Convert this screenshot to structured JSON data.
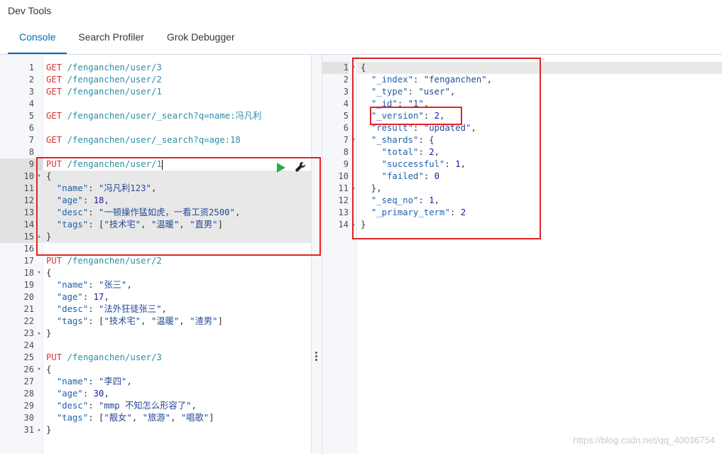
{
  "app": {
    "title": "Dev Tools"
  },
  "tabs": [
    {
      "label": "Console",
      "active": true
    },
    {
      "label": "Search Profiler",
      "active": false
    },
    {
      "label": "Grok Debugger",
      "active": false
    }
  ],
  "request_editor": {
    "lines": [
      {
        "n": "1",
        "tokens": [
          [
            "m",
            "GET "
          ],
          [
            "u",
            "/fenganchen/user/3"
          ]
        ]
      },
      {
        "n": "2",
        "tokens": [
          [
            "m",
            "GET "
          ],
          [
            "u",
            "/fenganchen/user/2"
          ]
        ]
      },
      {
        "n": "3",
        "tokens": [
          [
            "m",
            "GET "
          ],
          [
            "u",
            "/fenganchen/user/1"
          ]
        ]
      },
      {
        "n": "4",
        "tokens": []
      },
      {
        "n": "5",
        "tokens": [
          [
            "m",
            "GET "
          ],
          [
            "u",
            "/fenganchen/user/_search?q=name:冯凡利"
          ]
        ]
      },
      {
        "n": "6",
        "tokens": []
      },
      {
        "n": "7",
        "tokens": [
          [
            "m",
            "GET "
          ],
          [
            "u",
            "/fenganchen/user/_search?q=age:18"
          ]
        ]
      },
      {
        "n": "8",
        "tokens": []
      },
      {
        "n": "9",
        "tokens": [
          [
            "m",
            "PUT "
          ],
          [
            "u",
            "/fenganchen/user/1"
          ]
        ],
        "active": true,
        "cursor": true
      },
      {
        "n": "10",
        "fold": "▾",
        "tokens": [
          [
            "p",
            "{"
          ]
        ],
        "hl": true
      },
      {
        "n": "11",
        "tokens": [
          [
            "p",
            "  "
          ],
          [
            "k",
            "\"name\""
          ],
          [
            "p",
            ": "
          ],
          [
            "s",
            "\"冯凡利123\""
          ],
          [
            "p",
            ","
          ]
        ],
        "hl": true
      },
      {
        "n": "12",
        "tokens": [
          [
            "p",
            "  "
          ],
          [
            "k",
            "\"age\""
          ],
          [
            "p",
            ": "
          ],
          [
            "n",
            "18"
          ],
          [
            "p",
            ","
          ]
        ],
        "hl": true
      },
      {
        "n": "13",
        "tokens": [
          [
            "p",
            "  "
          ],
          [
            "k",
            "\"desc\""
          ],
          [
            "p",
            ": "
          ],
          [
            "s",
            "\"一顿操作猛如虎，一看工资2500\""
          ],
          [
            "p",
            ","
          ]
        ],
        "hl": true
      },
      {
        "n": "14",
        "tokens": [
          [
            "p",
            "  "
          ],
          [
            "k",
            "\"tags\""
          ],
          [
            "p",
            ": ["
          ],
          [
            "s",
            "\"技术宅\""
          ],
          [
            "p",
            ", "
          ],
          [
            "s",
            "\"温暖\""
          ],
          [
            "p",
            ", "
          ],
          [
            "s",
            "\"直男\""
          ],
          [
            "p",
            "]"
          ]
        ],
        "hl": true
      },
      {
        "n": "15",
        "fold": "▴",
        "tokens": [
          [
            "p",
            "}"
          ]
        ],
        "hl": true
      },
      {
        "n": "16",
        "tokens": []
      },
      {
        "n": "17",
        "tokens": [
          [
            "m",
            "PUT "
          ],
          [
            "u",
            "/fenganchen/user/2"
          ]
        ]
      },
      {
        "n": "18",
        "fold": "▾",
        "tokens": [
          [
            "p",
            "{"
          ]
        ]
      },
      {
        "n": "19",
        "tokens": [
          [
            "p",
            "  "
          ],
          [
            "k",
            "\"name\""
          ],
          [
            "p",
            ": "
          ],
          [
            "s",
            "\"张三\""
          ],
          [
            "p",
            ","
          ]
        ]
      },
      {
        "n": "20",
        "tokens": [
          [
            "p",
            "  "
          ],
          [
            "k",
            "\"age\""
          ],
          [
            "p",
            ": "
          ],
          [
            "n",
            "17"
          ],
          [
            "p",
            ","
          ]
        ]
      },
      {
        "n": "21",
        "tokens": [
          [
            "p",
            "  "
          ],
          [
            "k",
            "\"desc\""
          ],
          [
            "p",
            ": "
          ],
          [
            "s",
            "\"法外狂徒张三\""
          ],
          [
            "p",
            ","
          ]
        ]
      },
      {
        "n": "22",
        "tokens": [
          [
            "p",
            "  "
          ],
          [
            "k",
            "\"tags\""
          ],
          [
            "p",
            ": ["
          ],
          [
            "s",
            "\"技术宅\""
          ],
          [
            "p",
            ", "
          ],
          [
            "s",
            "\"温暖\""
          ],
          [
            "p",
            ", "
          ],
          [
            "s",
            "\"渣男\""
          ],
          [
            "p",
            "]"
          ]
        ]
      },
      {
        "n": "23",
        "fold": "▴",
        "tokens": [
          [
            "p",
            "}"
          ]
        ]
      },
      {
        "n": "24",
        "tokens": []
      },
      {
        "n": "25",
        "tokens": [
          [
            "m",
            "PUT "
          ],
          [
            "u",
            "/fenganchen/user/3"
          ]
        ]
      },
      {
        "n": "26",
        "fold": "▾",
        "tokens": [
          [
            "p",
            "{"
          ]
        ]
      },
      {
        "n": "27",
        "tokens": [
          [
            "p",
            "  "
          ],
          [
            "k",
            "\"name\""
          ],
          [
            "p",
            ": "
          ],
          [
            "s",
            "\"李四\""
          ],
          [
            "p",
            ","
          ]
        ]
      },
      {
        "n": "28",
        "tokens": [
          [
            "p",
            "  "
          ],
          [
            "k",
            "\"age\""
          ],
          [
            "p",
            ": "
          ],
          [
            "n",
            "30"
          ],
          [
            "p",
            ","
          ]
        ]
      },
      {
        "n": "29",
        "tokens": [
          [
            "p",
            "  "
          ],
          [
            "k",
            "\"desc\""
          ],
          [
            "p",
            ": "
          ],
          [
            "s",
            "\"mmp 不知怎么形容了\""
          ],
          [
            "p",
            ","
          ]
        ]
      },
      {
        "n": "30",
        "tokens": [
          [
            "p",
            "  "
          ],
          [
            "k",
            "\"tags\""
          ],
          [
            "p",
            ": ["
          ],
          [
            "s",
            "\"靓女\""
          ],
          [
            "p",
            ", "
          ],
          [
            "s",
            "\"旅游\""
          ],
          [
            "p",
            ", "
          ],
          [
            "s",
            "\"唱歌\""
          ],
          [
            "p",
            "]"
          ]
        ]
      },
      {
        "n": "31",
        "fold": "▴",
        "tokens": [
          [
            "p",
            "}"
          ]
        ]
      }
    ]
  },
  "response_viewer": {
    "lines": [
      {
        "n": "1",
        "fold": "▾",
        "tokens": [
          [
            "p",
            "{"
          ]
        ],
        "active": true
      },
      {
        "n": "2",
        "tokens": [
          [
            "p",
            "  "
          ],
          [
            "k",
            "\"_index\""
          ],
          [
            "p",
            ": "
          ],
          [
            "s",
            "\"fenganchen\""
          ],
          [
            "p",
            ","
          ]
        ]
      },
      {
        "n": "3",
        "tokens": [
          [
            "p",
            "  "
          ],
          [
            "k",
            "\"_type\""
          ],
          [
            "p",
            ": "
          ],
          [
            "s",
            "\"user\""
          ],
          [
            "p",
            ","
          ]
        ]
      },
      {
        "n": "4",
        "tokens": [
          [
            "p",
            "  "
          ],
          [
            "k",
            "\"_id\""
          ],
          [
            "p",
            ": "
          ],
          [
            "s",
            "\"1\""
          ],
          [
            "p",
            ","
          ]
        ]
      },
      {
        "n": "5",
        "tokens": [
          [
            "p",
            "  "
          ],
          [
            "k",
            "\"_version\""
          ],
          [
            "p",
            ": "
          ],
          [
            "n",
            "2"
          ],
          [
            "p",
            ","
          ]
        ]
      },
      {
        "n": "6",
        "tokens": [
          [
            "p",
            "  "
          ],
          [
            "k",
            "\"result\""
          ],
          [
            "p",
            ": "
          ],
          [
            "s",
            "\"updated\""
          ],
          [
            "p",
            ","
          ]
        ]
      },
      {
        "n": "7",
        "fold": "▾",
        "tokens": [
          [
            "p",
            "  "
          ],
          [
            "k",
            "\"_shards\""
          ],
          [
            "p",
            ": {"
          ]
        ]
      },
      {
        "n": "8",
        "tokens": [
          [
            "p",
            "    "
          ],
          [
            "k",
            "\"total\""
          ],
          [
            "p",
            ": "
          ],
          [
            "n",
            "2"
          ],
          [
            "p",
            ","
          ]
        ]
      },
      {
        "n": "9",
        "tokens": [
          [
            "p",
            "    "
          ],
          [
            "k",
            "\"successful\""
          ],
          [
            "p",
            ": "
          ],
          [
            "n",
            "1"
          ],
          [
            "p",
            ","
          ]
        ]
      },
      {
        "n": "10",
        "tokens": [
          [
            "p",
            "    "
          ],
          [
            "k",
            "\"failed\""
          ],
          [
            "p",
            ": "
          ],
          [
            "n",
            "0"
          ]
        ]
      },
      {
        "n": "11",
        "fold": "▴",
        "tokens": [
          [
            "p",
            "  },"
          ]
        ]
      },
      {
        "n": "12",
        "tokens": [
          [
            "p",
            "  "
          ],
          [
            "k",
            "\"_seq_no\""
          ],
          [
            "p",
            ": "
          ],
          [
            "n",
            "1"
          ],
          [
            "p",
            ","
          ]
        ]
      },
      {
        "n": "13",
        "tokens": [
          [
            "p",
            "  "
          ],
          [
            "k",
            "\"_primary_term\""
          ],
          [
            "p",
            ": "
          ],
          [
            "n",
            "2"
          ]
        ]
      },
      {
        "n": "14",
        "fold": "▴",
        "tokens": [
          [
            "p",
            "}"
          ]
        ]
      }
    ]
  },
  "icons": {
    "play": "play-icon",
    "wrench": "wrench-icon",
    "splitter": "vertical-dots-icon"
  },
  "colors": {
    "accent": "#006bb4",
    "method": "#e03232",
    "url": "#2e8ea6",
    "annotation": "#e32224",
    "play": "#2eaa4a"
  },
  "watermark": "https://blog.csdn.net/qq_40036754"
}
